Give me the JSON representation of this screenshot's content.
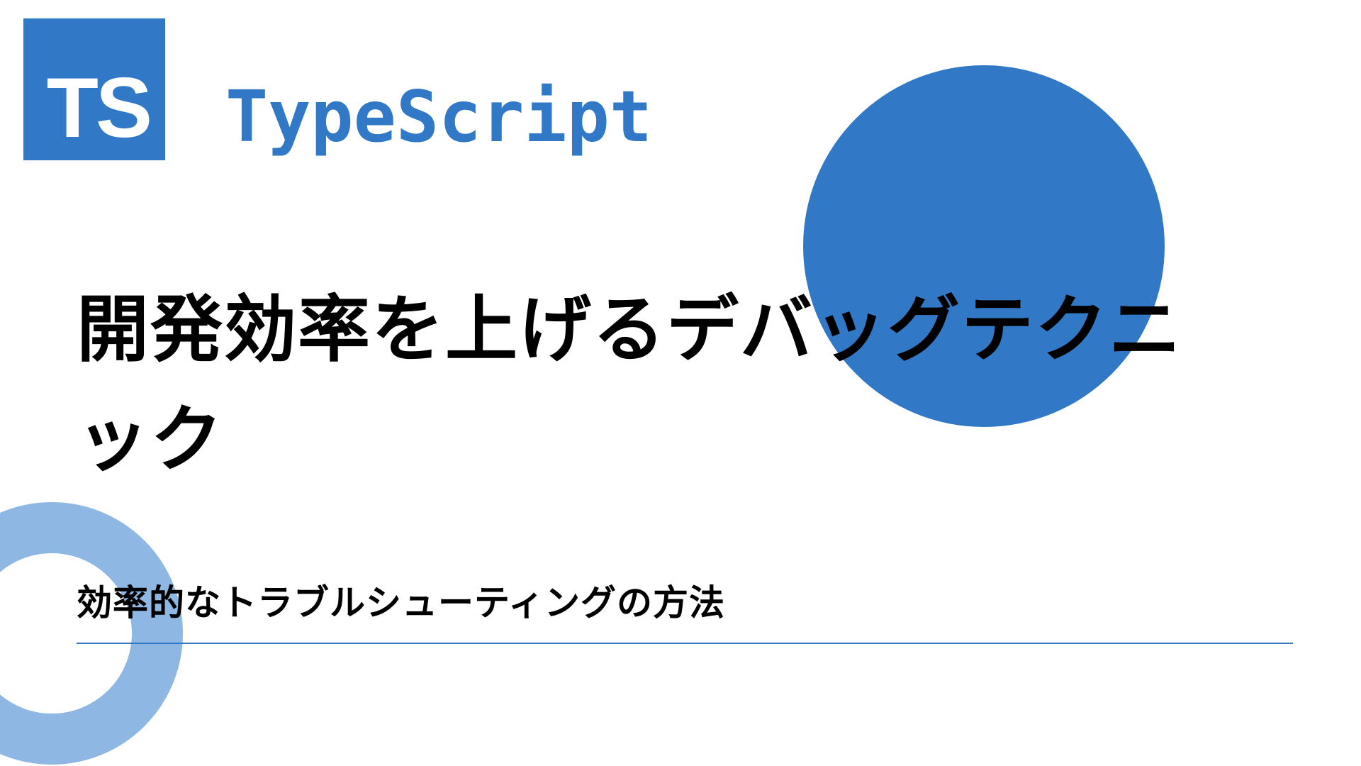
{
  "badge": {
    "text": "TS"
  },
  "brand": "TypeScript",
  "title": "開発効率を上げるデバッグテクニック",
  "subtitle": "効率的なトラブルシューティングの方法",
  "colors": {
    "accent": "#3178c6",
    "ring": "#8fb7e4"
  }
}
